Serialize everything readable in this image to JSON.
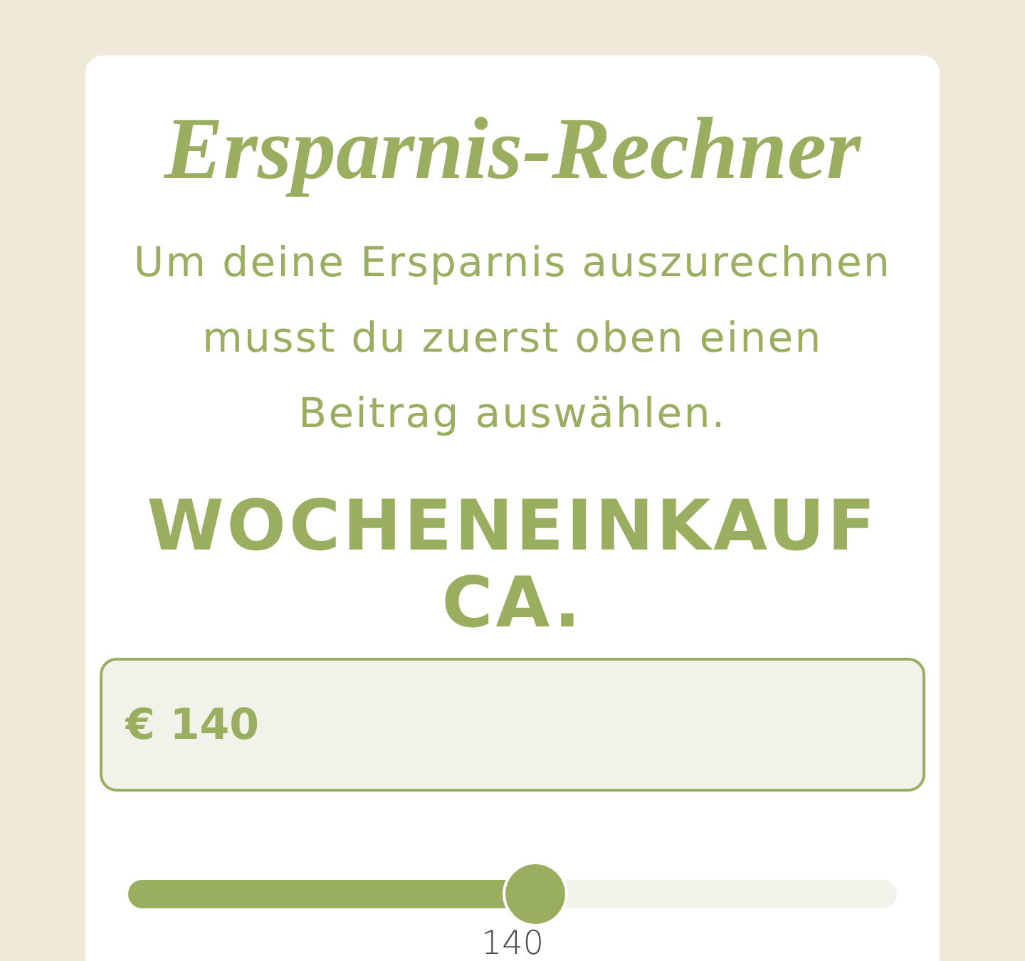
{
  "title": "Ersparnis-Rechner",
  "intro": "Um deine Ersparnis auszurechnen musst du zuerst oben einen Beitrag auswählen.",
  "heading": "WOCHENEINKAUF CA.",
  "amount_field": {
    "value": "€ 140"
  },
  "slider": {
    "level": 0.53,
    "reading": "140"
  }
}
